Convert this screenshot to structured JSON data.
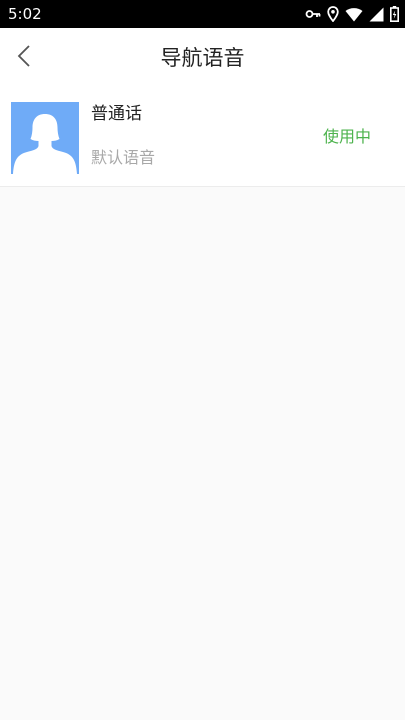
{
  "status_bar": {
    "time": "5:02",
    "icons": [
      "key-icon",
      "location-icon",
      "wifi-icon",
      "signal-icon",
      "battery-icon"
    ]
  },
  "header": {
    "back_icon": "chevron-left-icon",
    "title": "导航语音"
  },
  "voice_list": [
    {
      "name": "普通话",
      "description": "默认语音",
      "status": "使用中",
      "avatar_icon": "person-silhouette-icon"
    }
  ],
  "colors": {
    "status_bar_bg": "#000000",
    "avatar_bg": "#6fabf7",
    "active_status": "#4db34d",
    "secondary_text": "#a8a8a8",
    "page_bg": "#fafafa"
  }
}
